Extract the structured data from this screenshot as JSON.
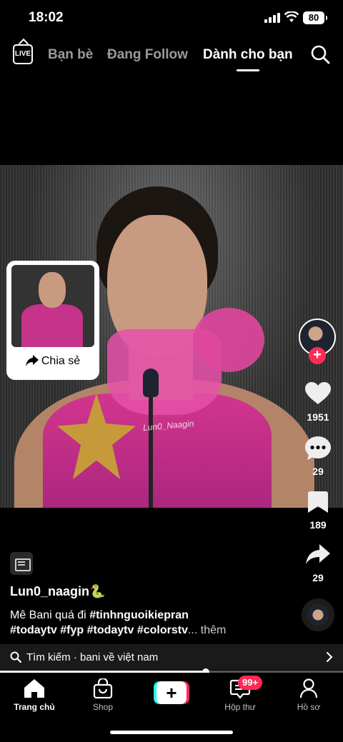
{
  "status_bar": {
    "time": "18:02",
    "battery": "80"
  },
  "top_nav": {
    "live_label": "LIVE",
    "tabs": [
      {
        "label": "Bạn bè",
        "active": false
      },
      {
        "label": "Đang Follow",
        "active": false
      },
      {
        "label": "Dành cho bạn",
        "active": true
      }
    ]
  },
  "video": {
    "watermark": "Lun0_Naagin"
  },
  "share_card": {
    "label": "Chia sẻ"
  },
  "actions": {
    "likes": "1951",
    "comments": "29",
    "saves": "189",
    "shares": "29"
  },
  "post": {
    "username": "Lun0_naagin🐍",
    "caption_text": "Mê Bani quá đi",
    "hashtags_line1": "#tinhnguoikiepran",
    "hashtags_line2": "#todaytv #fyp #todaytv #colorstv",
    "more": "... thêm"
  },
  "search_bar": {
    "text": "Tìm kiếm · bani về việt nam"
  },
  "playback": {
    "progress": 0.6
  },
  "bottom_nav": {
    "home": "Trang chủ",
    "shop": "Shop",
    "inbox": "Hộp thư",
    "inbox_badge": "99+",
    "profile": "Hồ sơ"
  },
  "colors": {
    "accent_red": "#fe2c55",
    "accent_cyan": "#25f4ee",
    "background": "#000000"
  }
}
